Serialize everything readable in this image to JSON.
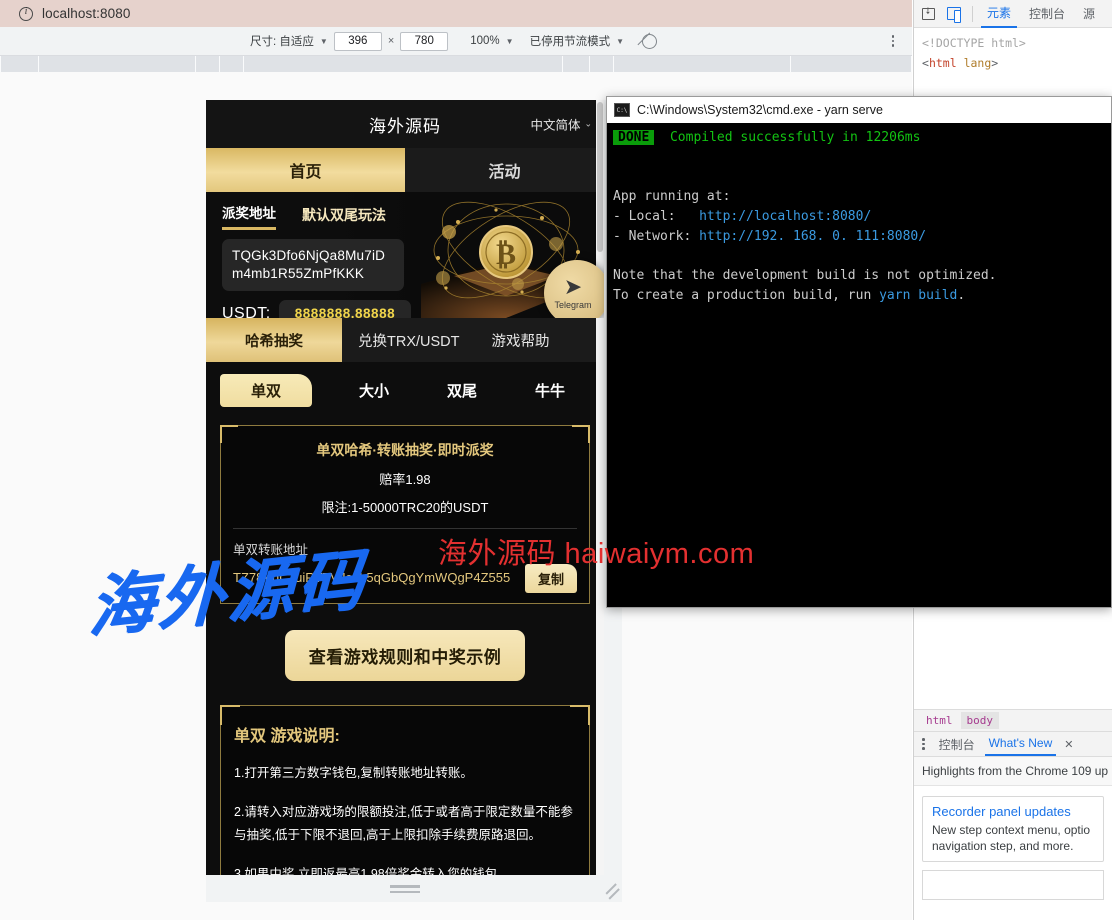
{
  "browser": {
    "url": "localhost:8080",
    "info_icon": "info-circle-icon"
  },
  "device_toolbar": {
    "size_label": "尺寸: 自适应",
    "width": "396",
    "height": "780",
    "times": "×",
    "zoom": "100%",
    "throttling": "已停用节流模式",
    "no_throttle_icon": "no-throttling-icon",
    "more_icon": "more-options-icon"
  },
  "cmd": {
    "title": "C:\\Windows\\System32\\cmd.exe - yarn  serve",
    "icon": "cmd-console-icon",
    "done_badge": "DONE",
    "compiled": "Compiled successfully in 12206ms",
    "app_running": "App running at:",
    "local_label": "- Local:   ",
    "local_url": "http://localhost:8080/",
    "network_label": "- Network: ",
    "network_url": "http://192. 168. 0. 111:8080/",
    "note_line1": "Note that the development build is not optimized.",
    "note_line2_a": "To create a production build, run ",
    "note_line2_b": "yarn build",
    "note_line2_c": "."
  },
  "app": {
    "title": "海外源码",
    "language": "中文简体",
    "lang_caret": "⌄",
    "top_tabs": [
      {
        "label": "首页",
        "active": true
      },
      {
        "label": "活动",
        "active": false
      }
    ],
    "hero": {
      "addr_tab_primary": "派奖地址",
      "addr_tab_secondary": "默认双尾玩法",
      "payout_address": "TQGk3Dfo6NjQa8Mu7iDm4mb1R55ZmPfKKK",
      "usdt_label": "USDT:",
      "usdt_value": "8888888.88888",
      "telegram_label": "Telegram",
      "telegram_icon": "paper-plane-icon"
    },
    "section_tabs": [
      {
        "label": "哈希抽奖",
        "active": true
      },
      {
        "label": "兑换TRX/USDT",
        "active": false
      },
      {
        "label": "游戏帮助",
        "active": false
      }
    ],
    "game_tabs": [
      {
        "label": "单双",
        "active": true
      },
      {
        "label": "大小",
        "active": false
      },
      {
        "label": "双尾",
        "active": false
      },
      {
        "label": "牛牛",
        "active": false
      }
    ],
    "game_panel": {
      "title": "单双哈希·转账抽奖·即时派奖",
      "odds": "赔率1.98",
      "limit": "限注:1-50000TRC20的USDT",
      "transfer_label": "单双转账地址",
      "transfer_address": "TZ78VhCJuiRTTVJcoL5qGbQgYmWQgP4Z555",
      "copy_label": "复制"
    },
    "rules_button": "查看游戏规则和中奖示例",
    "explain": {
      "title": "单双 游戏说明:",
      "items": [
        "1.打开第三方数字钱包,复制转账地址转账。",
        "2.请转入对应游戏场的限额投注,低于或者高于限定数量不能参与抽奖,低于下限不退回,高于上限扣除手续费原路退回。",
        "3.如果中奖,立即返最高1.98倍奖金转入您的钱包。"
      ]
    }
  },
  "watermarks": {
    "blue": "海外源码",
    "red": "海外源码 haiwaiym.com"
  },
  "devtools": {
    "inspect_icon": "inspect-element-icon",
    "device_icon": "toggle-device-toolbar-icon",
    "tabs": [
      {
        "label": "元素",
        "active": true
      },
      {
        "label": "控制台",
        "active": false
      },
      {
        "label": "源",
        "active": false
      }
    ],
    "tree": {
      "doctype": "<!DOCTYPE html>",
      "open_brk": "<",
      "tag": "html",
      "attr": "lang",
      "close_brk": ">"
    },
    "breadcrumb": [
      "html",
      "body"
    ],
    "drawer_kebab": "more-tools-icon",
    "drawer_tabs": [
      {
        "label": "控制台",
        "active": false
      },
      {
        "label": "What's New",
        "active": true
      }
    ],
    "drawer_close": "✕",
    "whats_new_subtitle": "Highlights from the Chrome 109 up",
    "cards": [
      {
        "title": "Recorder panel updates",
        "body": "New step context menu, optio navigation step, and more."
      }
    ]
  },
  "colors": {
    "gold": "#d9b863",
    "gold_light": "#f2dc9e",
    "panel_bg": "#070707",
    "app_bg": "#0d0d0d",
    "accent_blue": "#1a73e8",
    "terminal_green": "#13c413",
    "terminal_blue": "#3b9ae0",
    "usdt_yellow": "#f2d64a",
    "watermark_blue": "#1868f0",
    "watermark_red": "#e33030"
  }
}
